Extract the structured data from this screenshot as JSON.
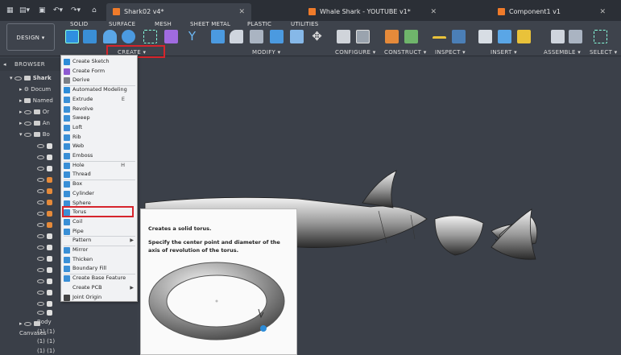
{
  "tabs": [
    {
      "label": "Shark02 v4*",
      "active": true
    },
    {
      "label": "Whale Shark - YOUTUBE v1*",
      "active": false
    },
    {
      "label": "Component1 v1",
      "active": false
    }
  ],
  "ribbon": {
    "tabs": [
      "SOLID",
      "SURFACE",
      "MESH",
      "SHEET METAL",
      "PLASTIC",
      "UTILITIES"
    ],
    "design_label": "DESIGN",
    "groups": [
      "CREATE",
      "MODIFY",
      "CONFIGURE",
      "CONSTRUCT",
      "INSPECT",
      "INSERT",
      "ASSEMBLE",
      "SELECT"
    ]
  },
  "browser": {
    "title": "BROWSER",
    "top_item": "Shark",
    "items": [
      "Docum",
      "Named",
      "Or",
      "An",
      "Bo"
    ],
    "last_body": "Body (1) (1) (1) (1) (1) (1)",
    "canvases": "Canvases"
  },
  "menu": {
    "items": [
      {
        "label": "Create Sketch",
        "shortcut": "",
        "color": "#2d8cd8"
      },
      {
        "label": "Create Form",
        "shortcut": "",
        "color": "#8d5ad1"
      },
      {
        "label": "Derive",
        "shortcut": "",
        "color": "#7a7f86"
      },
      {
        "label": "Automated Modeling",
        "shortcut": "",
        "color": "#2d8cd8"
      },
      {
        "label": "Extrude",
        "shortcut": "E",
        "color": "#3a8fd6"
      },
      {
        "label": "Revolve",
        "shortcut": "",
        "color": "#3a8fd6"
      },
      {
        "label": "Sweep",
        "shortcut": "",
        "color": "#3a8fd6"
      },
      {
        "label": "Loft",
        "shortcut": "",
        "color": "#3a8fd6"
      },
      {
        "label": "Rib",
        "shortcut": "",
        "color": "#3a8fd6"
      },
      {
        "label": "Web",
        "shortcut": "",
        "color": "#3a8fd6"
      },
      {
        "label": "Emboss",
        "shortcut": "",
        "color": "#3a8fd6"
      },
      {
        "label": "Hole",
        "shortcut": "H",
        "color": "#3a8fd6"
      },
      {
        "label": "Thread",
        "shortcut": "",
        "color": "#3a8fd6"
      },
      {
        "label": "Box",
        "shortcut": "",
        "color": "#3a8fd6"
      },
      {
        "label": "Cylinder",
        "shortcut": "",
        "color": "#3a8fd6"
      },
      {
        "label": "Sphere",
        "shortcut": "",
        "color": "#3a8fd6"
      },
      {
        "label": "Torus",
        "shortcut": "",
        "color": "#3a8fd6"
      },
      {
        "label": "Coil",
        "shortcut": "",
        "color": "#3a8fd6"
      },
      {
        "label": "Pipe",
        "shortcut": "",
        "color": "#3a8fd6"
      },
      {
        "label": "Pattern",
        "shortcut": "",
        "color": "",
        "submenu": true
      },
      {
        "label": "Mirror",
        "shortcut": "",
        "color": "#3a8fd6"
      },
      {
        "label": "Thicken",
        "shortcut": "",
        "color": "#3a8fd6"
      },
      {
        "label": "Boundary Fill",
        "shortcut": "",
        "color": "#3a8fd6"
      },
      {
        "label": "Create Base Feature",
        "shortcut": "",
        "color": "#3a8fd6"
      },
      {
        "label": "Create PCB",
        "shortcut": "",
        "color": "",
        "submenu": true
      },
      {
        "label": "Joint Origin",
        "shortcut": "",
        "color": "#444"
      }
    ]
  },
  "tooltip": {
    "title": "Creates a solid torus.",
    "body": "Specify the center point and diameter of the axis of revolution of the torus."
  },
  "colors": {
    "accent_red": "#d6252c",
    "brand_orange": "#f07b2a"
  }
}
